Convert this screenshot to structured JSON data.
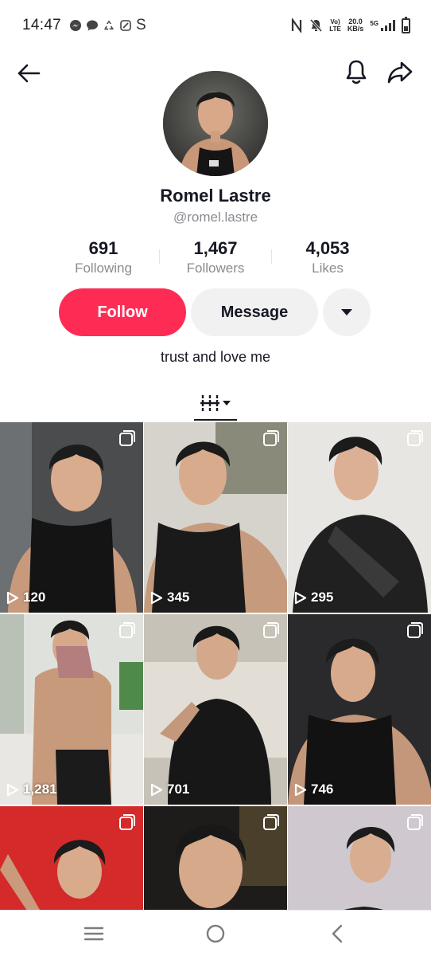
{
  "status_bar": {
    "time": "14:47",
    "carrier_letter": "S",
    "volte_top": "Vo)",
    "volte_bottom": "LTE",
    "speed_value": "20.0",
    "speed_unit": "KB/s",
    "network": "5G",
    "icons": [
      "messenger-icon",
      "chat-bubble-icon",
      "recycle-icon",
      "sim-icon",
      "nfc-icon",
      "mute-bell-icon",
      "signal-icon",
      "battery-icon"
    ]
  },
  "header": {
    "back_icon": "arrow-left-icon",
    "bell_icon": "bell-icon",
    "share_icon": "share-arrow-icon"
  },
  "profile": {
    "display_name": "Romel Lastre",
    "username": "@romel.lastre",
    "bio": "trust and love me"
  },
  "stats": [
    {
      "value": "691",
      "label": "Following"
    },
    {
      "value": "1,467",
      "label": "Followers"
    },
    {
      "value": "4,053",
      "label": "Likes"
    }
  ],
  "actions": {
    "follow_label": "Follow",
    "message_label": "Message",
    "follow_color": "#fe2c55"
  },
  "tabs": {
    "active_icon": "videos-grid-icon"
  },
  "videos": [
    {
      "views": "120"
    },
    {
      "views": "345"
    },
    {
      "views": "295"
    },
    {
      "views": "1,281"
    },
    {
      "views": "701"
    },
    {
      "views": "746"
    },
    {
      "views": ""
    },
    {
      "views": ""
    },
    {
      "views": ""
    }
  ],
  "nav_bar": {
    "icons": [
      "menu-icon",
      "home-circle-icon",
      "back-chevron-icon"
    ]
  }
}
